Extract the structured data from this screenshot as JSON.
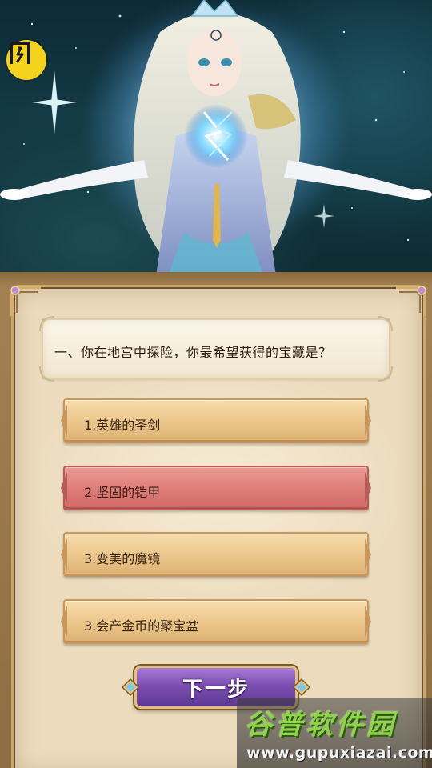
{
  "app": {
    "logo_glyph": "闪",
    "logo_color": "#f5d21b"
  },
  "quiz": {
    "question": "一、你在地宫中探险，你最希望获得的宝藏是？",
    "options": [
      {
        "label": "1.英雄的圣剑",
        "state": "normal"
      },
      {
        "label": "2.坚固的铠甲",
        "state": "selected"
      },
      {
        "label": "3.变美的魔镜",
        "state": "normal"
      },
      {
        "label": "3.会产金币的聚宝盆",
        "state": "normal"
      }
    ],
    "next_label": "下一步"
  },
  "watermark": {
    "title": "谷普软件园",
    "url": "www.gupuxiazai.com"
  },
  "colors": {
    "option_normal": "#ebc68a",
    "option_selected": "#de7c77",
    "next_button": "#7d4fb2",
    "panel_bg": "#ecdcbd",
    "watermark_title": "#8fd14b"
  }
}
